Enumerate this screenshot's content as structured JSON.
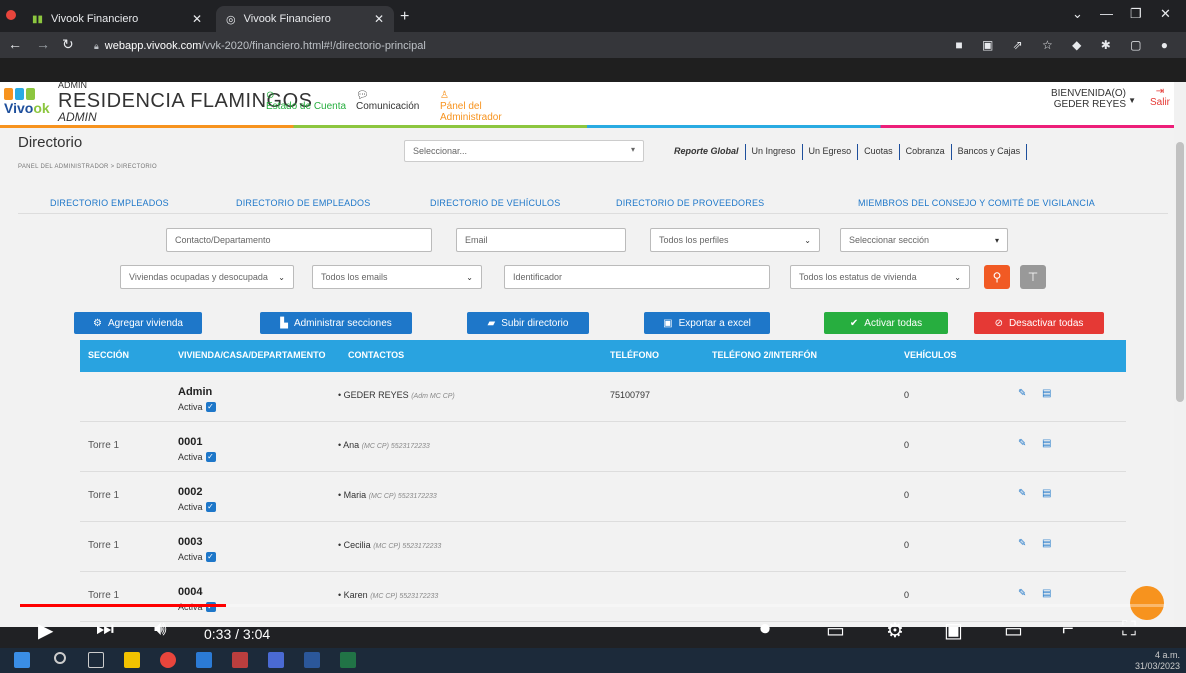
{
  "browser": {
    "tabs": [
      {
        "label": "Vivook Financiero",
        "active": false
      },
      {
        "label": "Vivook Financiero",
        "active": true
      }
    ],
    "url_host": "webapp.vivook.com",
    "url_path": "/vvk-2020/financiero.html#!/directorio-principal"
  },
  "header": {
    "admin_small": "ADMIN",
    "residence_name": "RESIDENCIA FLAMINGOS",
    "admin_italic": "ADMIN",
    "nav": [
      {
        "label": "Estado de Cuenta"
      },
      {
        "label": "Comunicación"
      },
      {
        "label": "Pánel del Administrador"
      }
    ],
    "welcome_label": "BIENVENIDA(O)",
    "user_name": "GEDER REYES",
    "logout_label": "Salir",
    "logo_text_a": "Vivo",
    "logo_text_b": "ok"
  },
  "page": {
    "title": "Directorio",
    "breadcrumb": "PANEL DEL ADMINISTRADOR > DIRECTORIO",
    "main_select_placeholder": "Seleccionar...",
    "top_links": [
      "Reporte Global",
      "Un Ingreso",
      "Un Egreso",
      "Cuotas",
      "Cobranza",
      "Bancos y Cajas"
    ]
  },
  "directory_tabs": [
    "DIRECTORIO EMPLEADOS",
    "DIRECTORIO DE EMPLEADOS",
    "DIRECTORIO DE VEHÍCULOS",
    "DIRECTORIO DE PROVEEDORES",
    "MIEMBROS DEL CONSEJO Y COMITÉ DE VIGILANCIA"
  ],
  "filters": {
    "contacto_placeholder": "Contacto/Departamento",
    "email_placeholder": "Email",
    "perfiles_value": "Todos los perfiles",
    "seccion_value": "Seleccionar sección",
    "viviendas_value": "Viviendas ocupadas y desocupada",
    "emails_value": "Todos los emails",
    "identificador_placeholder": "Identificador",
    "estatus_value": "Todos los estatus de vivienda"
  },
  "actions": {
    "agregar": "Agregar vivienda",
    "administrar": "Administrar secciones",
    "subir": "Subir directorio",
    "exportar": "Exportar a excel",
    "activar": "Activar todas",
    "desactivar": "Desactivar todas"
  },
  "table": {
    "headers": [
      "SECCIÓN",
      "VIVIENDA/CASA/DEPARTAMENTO",
      "CONTACTOS",
      "TELÉFONO",
      "TELÉFONO 2/INTERFÓN",
      "VEHÍCULOS"
    ],
    "rows": [
      {
        "seccion": "",
        "vivienda": "Admin",
        "estado": "Activa",
        "contacto": "GEDER REYES",
        "contacto_info": "(Adm MC CP)",
        "telefono": "75100797",
        "vehiculos": "0"
      },
      {
        "seccion": "Torre 1",
        "vivienda": "0001",
        "estado": "Activa",
        "contacto": "Ana",
        "contacto_info": "(MC CP) 5523172233",
        "telefono": "",
        "vehiculos": "0"
      },
      {
        "seccion": "Torre 1",
        "vivienda": "0002",
        "estado": "Activa",
        "contacto": "Maria",
        "contacto_info": "(MC CP) 5523172233",
        "telefono": "",
        "vehiculos": "0"
      },
      {
        "seccion": "Torre 1",
        "vivienda": "0003",
        "estado": "Activa",
        "contacto": "Cecilia",
        "contacto_info": "(MC CP) 5523172233",
        "telefono": "",
        "vehiculos": "0"
      },
      {
        "seccion": "Torre 1",
        "vivienda": "0004",
        "estado": "Activa",
        "contacto": "Karen",
        "contacto_info": "(MC CP) 5523172233",
        "telefono": "",
        "vehiculos": "0"
      }
    ]
  },
  "video": {
    "time": "0:33 / 3:04",
    "progress_fraction": 0.18
  },
  "clock": {
    "time": "4 a.m.",
    "date": "31/03/2023"
  },
  "colors": {
    "accent_blue": "#1e77c9",
    "header_blue": "#29a3e0",
    "green": "#27ae3f",
    "red": "#e53935",
    "orange": "#f15a24"
  }
}
